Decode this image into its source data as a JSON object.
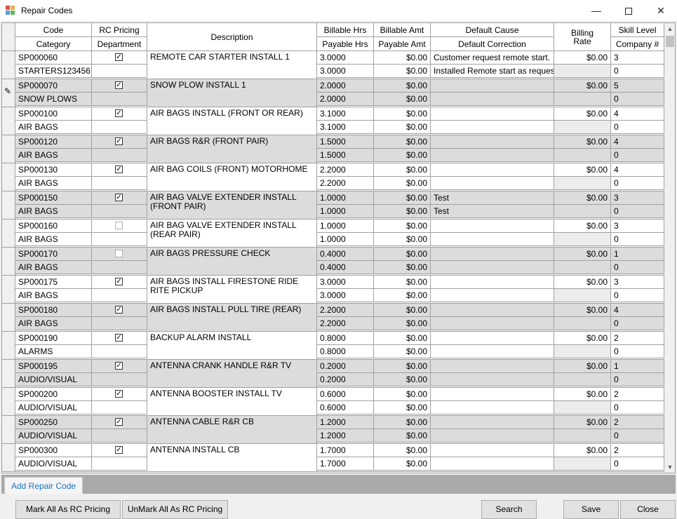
{
  "window": {
    "title": "Repair Codes"
  },
  "columns": {
    "code": "Code",
    "category": "Category",
    "rc_pricing": "RC Pricing",
    "department": "Department",
    "description": "Description",
    "billable_hrs": "Billable Hrs",
    "payable_hrs": "Payable Hrs",
    "billable_amt": "Billable Amt",
    "payable_amt": "Payable Amt",
    "default_cause": "Default Cause",
    "default_correction": "Default Correction",
    "billing_rate_1": "Billing",
    "billing_rate_2": "Rate",
    "skill_level": "Skill Level",
    "company": "Company #"
  },
  "rows": [
    {
      "code": "SP000060",
      "category": "STARTERS123456",
      "rc": true,
      "desc": "REMOTE CAR STARTER  INSTALL 1",
      "bhrs": "3.0000",
      "phrs": "3.0000",
      "bamt": "$0.00",
      "pamt": "$0.00",
      "cause": "Customer request remote start.",
      "corr": "Installed Remote start as request",
      "rate": "$0.00",
      "skill": "3",
      "company": "0"
    },
    {
      "code": "SP000070",
      "category": "SNOW PLOWS",
      "rc": true,
      "desc": "SNOW PLOW  INSTALL 1",
      "bhrs": "2.0000",
      "phrs": "2.0000",
      "bamt": "$0.00",
      "pamt": "$0.00",
      "cause": "",
      "corr": "",
      "rate": "$0.00",
      "skill": "5",
      "company": "0"
    },
    {
      "code": "SP000100",
      "category": "AIR BAGS",
      "rc": true,
      "desc": "AIR BAGS  INSTALL  (FRONT OR REAR)",
      "bhrs": "3.1000",
      "phrs": "3.1000",
      "bamt": "$0.00",
      "pamt": "$0.00",
      "cause": "",
      "corr": "",
      "rate": "$0.00",
      "skill": "4",
      "company": "0"
    },
    {
      "code": "SP000120",
      "category": "AIR BAGS",
      "rc": true,
      "desc": "AIR BAGS  R&R  (FRONT PAIR)",
      "bhrs": "1.5000",
      "phrs": "1.5000",
      "bamt": "$0.00",
      "pamt": "$0.00",
      "cause": "",
      "corr": "",
      "rate": "$0.00",
      "skill": "4",
      "company": "0"
    },
    {
      "code": "SP000130",
      "category": "AIR BAGS",
      "rc": true,
      "desc": "AIR BAG COILS  (FRONT) MOTORHOME",
      "bhrs": "2.2000",
      "phrs": "2.2000",
      "bamt": "$0.00",
      "pamt": "$0.00",
      "cause": "",
      "corr": "",
      "rate": "$0.00",
      "skill": "4",
      "company": "0"
    },
    {
      "code": "SP000150",
      "category": "AIR BAGS",
      "rc": true,
      "desc": "AIR BAG VALVE EXTENDER  INSTALL  (FRONT PAIR)",
      "bhrs": "1.0000",
      "phrs": "1.0000",
      "bamt": "$0.00",
      "pamt": "$0.00",
      "cause": "Test",
      "corr": "Test",
      "rate": "$0.00",
      "skill": "3",
      "company": "0"
    },
    {
      "code": "SP000160",
      "category": "AIR BAGS",
      "rc": false,
      "desc": "AIR BAG VALVE EXTENDER  INSTALL  (REAR PAIR)",
      "bhrs": "1.0000",
      "phrs": "1.0000",
      "bamt": "$0.00",
      "pamt": "$0.00",
      "cause": "",
      "corr": "",
      "rate": "$0.00",
      "skill": "3",
      "company": "0"
    },
    {
      "code": "SP000170",
      "category": "AIR BAGS",
      "rc": false,
      "desc": "AIR BAGS  PRESSURE CHECK",
      "bhrs": "0.4000",
      "phrs": "0.4000",
      "bamt": "$0.00",
      "pamt": "$0.00",
      "cause": "",
      "corr": "",
      "rate": "$0.00",
      "skill": "1",
      "company": "0"
    },
    {
      "code": "SP000175",
      "category": "AIR BAGS",
      "rc": true,
      "desc": "AIR BAGS  INSTALL  FIRESTONE RIDE RITE PICKUP",
      "bhrs": "3.0000",
      "phrs": "3.0000",
      "bamt": "$0.00",
      "pamt": "$0.00",
      "cause": "",
      "corr": "",
      "rate": "$0.00",
      "skill": "3",
      "company": "0"
    },
    {
      "code": "SP000180",
      "category": "AIR BAGS",
      "rc": true,
      "desc": "AIR BAGS  INSTALL  PULL TIRE (REAR)",
      "bhrs": "2.2000",
      "phrs": "2.2000",
      "bamt": "$0.00",
      "pamt": "$0.00",
      "cause": "",
      "corr": "",
      "rate": "$0.00",
      "skill": "4",
      "company": "0"
    },
    {
      "code": "SP000190",
      "category": "ALARMS",
      "rc": true,
      "desc": "BACKUP ALARM  INSTALL",
      "bhrs": "0.8000",
      "phrs": "0.8000",
      "bamt": "$0.00",
      "pamt": "$0.00",
      "cause": "",
      "corr": "",
      "rate": "$0.00",
      "skill": "2",
      "company": "0"
    },
    {
      "code": "SP000195",
      "category": "AUDIO/VISUAL",
      "rc": true,
      "desc": "ANTENNA CRANK HANDLE  R&R  TV",
      "bhrs": "0.2000",
      "phrs": "0.2000",
      "bamt": "$0.00",
      "pamt": "$0.00",
      "cause": "",
      "corr": "",
      "rate": "$0.00",
      "skill": "1",
      "company": "0"
    },
    {
      "code": "SP000200",
      "category": "AUDIO/VISUAL",
      "rc": true,
      "desc": "ANTENNA BOOSTER  INSTALL  TV",
      "bhrs": "0.6000",
      "phrs": "0.6000",
      "bamt": "$0.00",
      "pamt": "$0.00",
      "cause": "",
      "corr": "",
      "rate": "$0.00",
      "skill": "2",
      "company": "0"
    },
    {
      "code": "SP000250",
      "category": "AUDIO/VISUAL",
      "rc": true,
      "desc": "ANTENNA CABLE  R&R  CB",
      "bhrs": "1.2000",
      "phrs": "1.2000",
      "bamt": "$0.00",
      "pamt": "$0.00",
      "cause": "",
      "corr": "",
      "rate": "$0.00",
      "skill": "2",
      "company": "0"
    },
    {
      "code": "SP000300",
      "category": "AUDIO/VISUAL",
      "rc": true,
      "desc": "ANTENNA  INSTALL  CB",
      "bhrs": "1.7000",
      "phrs": "1.7000",
      "bamt": "$0.00",
      "pamt": "$0.00",
      "cause": "",
      "corr": "",
      "rate": "$0.00",
      "skill": "2",
      "company": "0"
    }
  ],
  "tabs": {
    "add_repair_code": "Add Repair Code"
  },
  "buttons": {
    "mark_all": "Mark All As RC Pricing",
    "unmark_all": "UnMark All As RC Pricing",
    "search": "Search",
    "save": "Save",
    "close": "Close"
  },
  "icons": {
    "edit_row": "pencil-icon",
    "checkbox": "check-icon"
  }
}
